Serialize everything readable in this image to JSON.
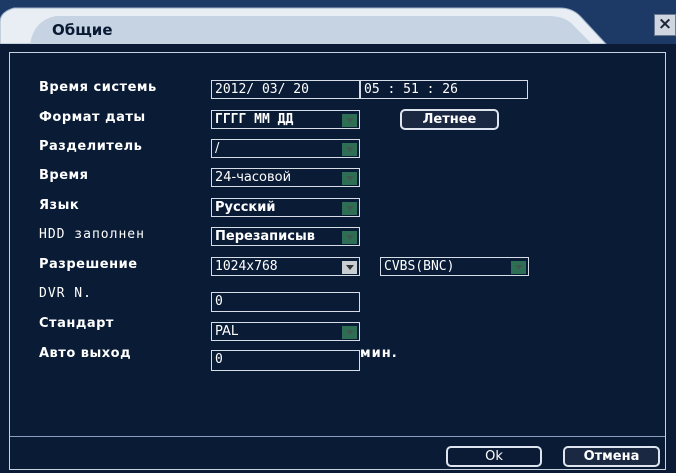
{
  "dialog": {
    "title": "Общие",
    "close_glyph": "×"
  },
  "fields": {
    "system_time": {
      "label": "Время системь",
      "date": "2012/ 03/ 20",
      "time": "05 : 51 : 26"
    },
    "date_format": {
      "label": "Формат даты",
      "value": "ГГГГ ММ ДД",
      "dst_button": "Летнее"
    },
    "separator": {
      "label": "Разделитель",
      "value": "/"
    },
    "time_format": {
      "label": "Время",
      "value": "24-часовой"
    },
    "language": {
      "label": "Язык",
      "value": "Русский"
    },
    "hdd_full": {
      "label": "HDD заполнен",
      "value": "Перезаписыв"
    },
    "resolution": {
      "label": "Разрешение",
      "value": "1024x768",
      "output": "CVBS(BNC)"
    },
    "dvr_no": {
      "label": "DVR N.",
      "value": "0"
    },
    "standard": {
      "label": "Стандарт",
      "value": "PAL"
    },
    "auto_logout": {
      "label": "Авто выход",
      "value": "0",
      "unit": "мин."
    }
  },
  "buttons": {
    "ok": "Ok",
    "cancel": "Отмена"
  }
}
